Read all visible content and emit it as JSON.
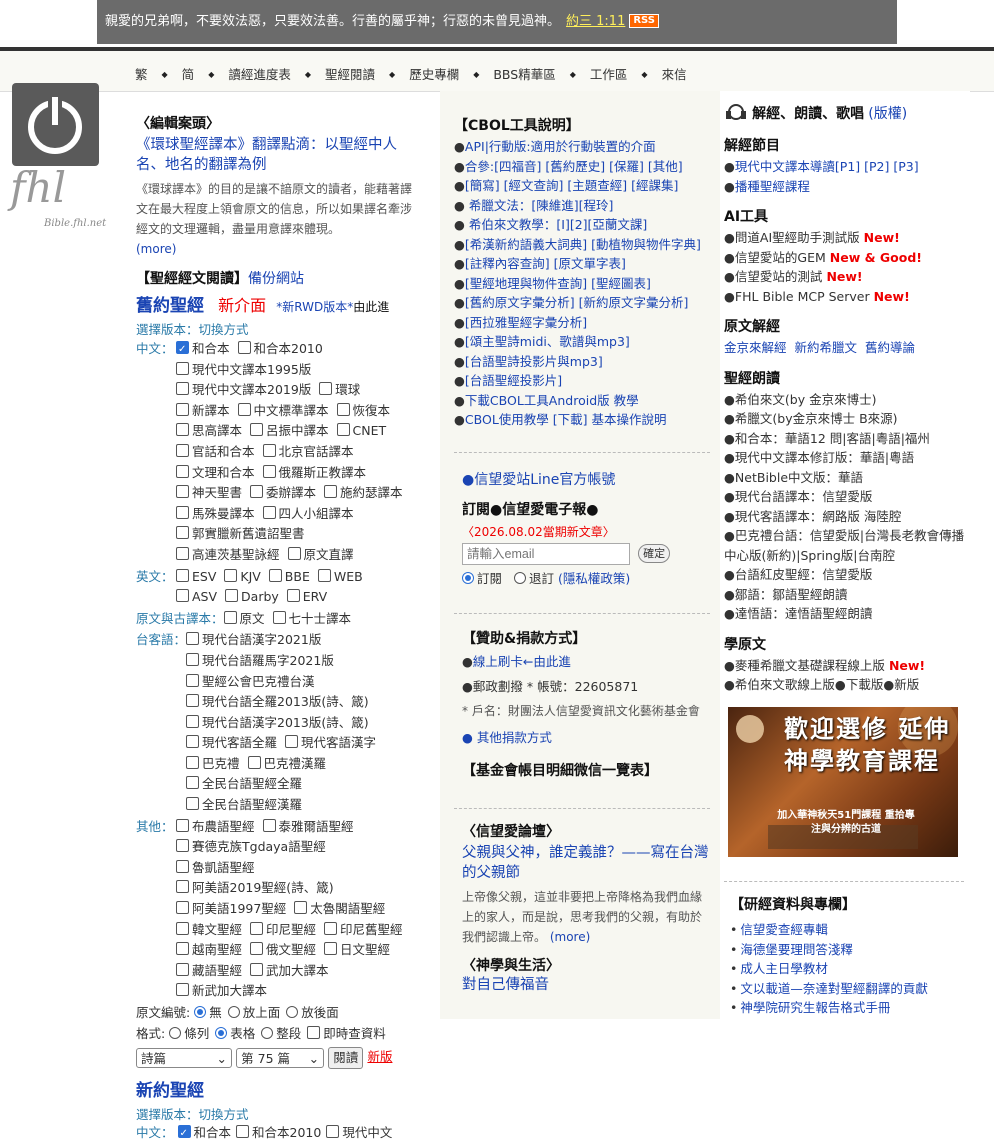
{
  "banner": {
    "verse": "親愛的兄弟啊，不要效法惡，只要效法善。行善的屬乎神；行惡的未曾見過神。",
    "ref": "約三 1:11",
    "rss": "RSS"
  },
  "nav": [
    "繁",
    "简",
    "讀經進度表",
    "聖經閱讀",
    "歷史專欄",
    "BBS精華區",
    "工作區",
    "來信"
  ],
  "logo": {
    "text": "fhl",
    "sub": "Bible.fhl.net"
  },
  "left": {
    "editor_head": "〈編輯案頭〉",
    "editor_link": "《環球聖經譯本》翻譯點滴：以聖經中人名、地名的翻譯為例",
    "editor_para": "《環球譯本》的目的是讓不諳原文的讀者，能藉著譯文在最大程度上領會原文的信息，所以如果譯名牽涉經文的文理邏輯，盡量用意譯來體現。",
    "more": "(more)",
    "reading_head": "【聖經經文閱讀】",
    "backup": "備份網站",
    "ot_title": "舊約聖經",
    "new_ui": "新介面",
    "rwd": "*新RWD版本*",
    "rwd_here": "由此進",
    "version_select": "選擇版本：切換方式",
    "chinese_label": "中文：",
    "chinese_opts": [
      "和合本",
      "和合本2010",
      "現代中文譯本1995版",
      "現代中文譯本2019版",
      "環球",
      "新譯本",
      "中文標準譯本",
      "恢復本",
      "思高譯本",
      "呂振中譯本",
      "CNET",
      "官話和合本",
      "北京官話譯本",
      "文理和合本",
      "俄羅斯正教譯本",
      "神天聖書",
      "委辦譯本",
      "施約瑟譯本",
      "馬殊曼譯本",
      "四人小組譯本",
      "郭實臘新舊遺詔聖書",
      "高連茨基聖詠經",
      "原文直譯"
    ],
    "english_label": "英文：",
    "english_opts": [
      "ESV",
      "KJV",
      "BBE",
      "WEB",
      "ASV",
      "Darby",
      "ERV"
    ],
    "orig_label": "原文與古譯本：",
    "orig_opts": [
      "原文",
      "七十士譯本"
    ],
    "taigi_label": "台客語：",
    "taigi_opts": [
      "現代台語漢字2021版",
      "現代台語羅馬字2021版",
      "聖經公會巴克禮台漢",
      "現代台語全羅2013版(詩、箴)",
      "現代台語漢字2013版(詩、箴)",
      "現代客語全羅",
      "現代客語漢字",
      "巴克禮",
      "巴克禮漢羅",
      "全民台語聖經全羅",
      "全民台語聖經漢羅"
    ],
    "other_label": "其他：",
    "other_opts": [
      "布農語聖經",
      "泰雅爾語聖經",
      "賽德克族Tgdaya語聖經",
      "魯凱語聖經",
      "阿美語2019聖經(詩、箴)",
      "阿美語1997聖經",
      "太魯閣語聖經",
      "韓文聖經",
      "印尼聖經",
      "印尼舊聖經",
      "越南聖經",
      "俄文聖經",
      "日文聖經",
      "藏語聖經",
      "武加大譯本",
      "新武加大譯本"
    ],
    "code_label": "原文編號:",
    "code_opts": [
      "無",
      "放上面",
      "放後面"
    ],
    "format_label": "格式:",
    "format_opts": [
      "條列",
      "表格",
      "整段",
      "即時查資料"
    ],
    "book": "詩篇",
    "chapter": "第 75 篇",
    "read_btn": "閱讀",
    "new_ver": "新版",
    "nt_title": "新約聖經",
    "nt_version_select": "選擇版本：切換方式",
    "nt_chinese_label": "中文：",
    "nt_opts": [
      "和合本",
      "和合本2010",
      "現代中文"
    ]
  },
  "mid": {
    "cbol_head": "【CBOL工具說明】",
    "cbol_items": [
      "API|行動版:適用於行動裝置的介面",
      "合參:[四福音] [舊約歷史] [保羅] [其他]",
      "[簡寫] [經文查詢] [主題查經] [經課集]",
      " 希臘文法：[陳維進][程玲]",
      " 希伯來文教學：[I][2][亞蘭文課]",
      "[希漢新約語義大詞典] [動植物與物件字典]",
      "[註釋內容查詢] [原文單字表]",
      "[聖經地理與物件查詢] [聖經圖表]",
      "[舊約原文字彙分析] [新約原文字彙分析]",
      "[西拉雅聖經字彙分析]",
      "[頌主聖詩midi、歌譜與mp3]",
      "[台語聖詩投影片與mp3]",
      "[台語聖經投影片]",
      "下載CBOL工具Android版 教學",
      "CBOL使用教學 [下載] 基本操作說明"
    ],
    "line_account": "●信望愛站Line官方帳號",
    "subscribe_head": "訂閱●信望愛電子報●",
    "latest": "〈2026.08.02當期新文章〉",
    "email_placeholder": "請輸入email",
    "confirm": "確定",
    "subscribe": "訂閱",
    "unsubscribe": "退訂",
    "privacy": "(隱私權政策)",
    "donate_head": "【贊助&捐款方式】",
    "donate_items": [
      "線上刷卡←由此進",
      "郵政劃撥 * 帳號：22605871"
    ],
    "account_name": "* 戶名：財團法人信望愛資訊文化藝術基金會",
    "other_donate": "● 其他捐款方式",
    "ledger": "【基金會帳目明細微信一覽表】",
    "forum_head": "〈信望愛論壇〉",
    "forum_link": "父親與父神，誰定義誰？——寫在台灣的父親節",
    "forum_para": "上帝像父親，這並非要把上帝降格為我們血緣上的家人，而是說，思考我們的父親，有助於我們認識上帝。",
    "forum_more": "(more)",
    "theology_head": "〈神學與生活〉",
    "theology_link": "對自己傳福音"
  },
  "right": {
    "title": "解經、朗讀、歌唱",
    "title_link": "(版權)",
    "exeg_head": "解經節目",
    "exeg_items": [
      "現代中文譯本導讀[P1] [P2] [P3]",
      "播種聖經課程"
    ],
    "ai_head": "AI工具",
    "ai_items": [
      {
        "text": "問道AI聖經助手測試版",
        "badge": "New!"
      },
      {
        "text": "信望愛站的GEM",
        "badge": "New & Good!"
      },
      {
        "text": "信望愛站的測試",
        "badge": "New!"
      },
      {
        "text": "FHL Bible MCP Server",
        "badge": "New!"
      }
    ],
    "orig_head": "原文解經",
    "orig_links": [
      "金京來解經",
      "新約希臘文",
      "舊約導論"
    ],
    "read_head": "聖經朗讀",
    "read_items": [
      "希伯來文(by 金京來博士)",
      "希臘文(by金京來博士 B來源)",
      "和合本：華語12 問|客語|粵語|福州",
      "現代中文譯本修訂版：華語|粵語",
      "NetBible中文版：華語",
      "現代台語譯本：信望愛版",
      "現代客語譯本：網路版 海陸腔",
      "巴克禮台語：信望愛版|台灣長老教會傳播中心版(新約)|Spring版|台南腔",
      "台語紅皮聖經：信望愛版",
      "鄒語：鄒語聖經朗讀",
      "達悟語：達悟語聖經朗讀"
    ],
    "learn_head": "學原文",
    "learn_items": [
      {
        "text": "麥種希臘文基礎課程線上版",
        "badge": "New!"
      },
      {
        "text": "希伯來文歌線上版●下載版●新版",
        "badge": ""
      }
    ],
    "promo_title": "歡迎選修 延伸神學教育課程",
    "promo_sub": "加入華神秋天51門課程 重拾專注與分辨的古道",
    "research_head": "【研經資料與專欄】",
    "research_items": [
      "信望愛查經專輯",
      "海德堡要理問答淺釋",
      "成人主日學教材",
      "文以載道—奈達對聖經翻譯的貢獻",
      "神學院研究生報告格式手冊"
    ]
  }
}
